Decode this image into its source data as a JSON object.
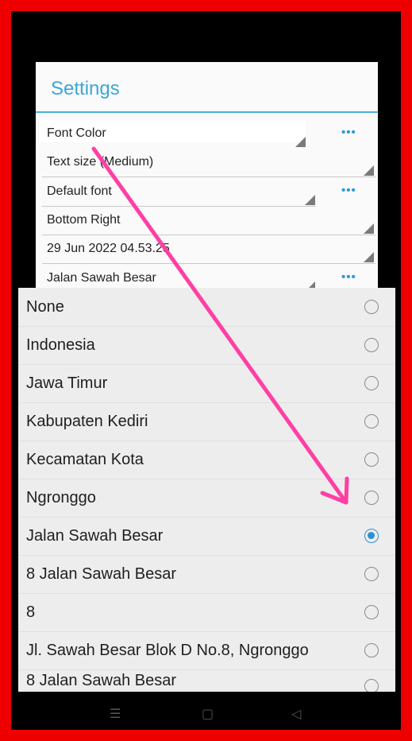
{
  "settings": {
    "title": "Settings",
    "rows": [
      {
        "label": "Font Color",
        "has_menu": true
      },
      {
        "label": "Text size (Medium)",
        "has_menu": false
      },
      {
        "label": "Default font",
        "has_menu": true
      },
      {
        "label": "Bottom Right",
        "has_menu": false
      },
      {
        "label": "29 Jun 2022 04.53.25",
        "has_menu": false
      },
      {
        "label": "Jalan Sawah Besar",
        "has_menu": true
      }
    ],
    "menu_icon": "more-dots-icon"
  },
  "dialog": {
    "options": [
      {
        "label": "None",
        "selected": false
      },
      {
        "label": "Indonesia",
        "selected": false
      },
      {
        "label": "Jawa Timur",
        "selected": false
      },
      {
        "label": "Kabupaten Kediri",
        "selected": false
      },
      {
        "label": "Kecamatan Kota",
        "selected": false
      },
      {
        "label": "Ngronggo",
        "selected": false
      },
      {
        "label": "Jalan Sawah Besar",
        "selected": true
      },
      {
        "label": "8 Jalan Sawah Besar",
        "selected": false
      },
      {
        "label": "8",
        "selected": false
      },
      {
        "label": "Jl. Sawah Besar Blok D No.8, Ngronggo",
        "selected": false
      },
      {
        "label": "8 Jalan Sawah Besar",
        "selected": false
      }
    ]
  },
  "nav": {
    "icons": [
      "menu-icon",
      "home-icon",
      "back-icon"
    ],
    "symbols": [
      "☰",
      "▢",
      "◁"
    ]
  },
  "colors": {
    "frame": "#ee0000",
    "accent": "#3aa7d6",
    "arrow": "#ff3fa4"
  }
}
